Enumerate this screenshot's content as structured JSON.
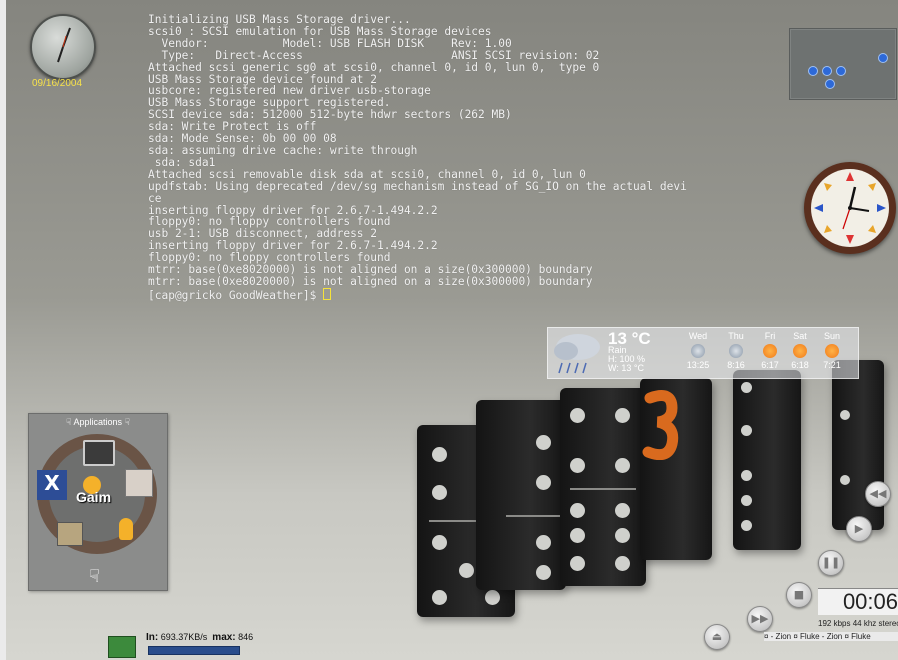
{
  "clock_widget": {
    "date": "09/16/2004"
  },
  "terminal": {
    "lines": [
      "Initializing USB Mass Storage driver...",
      "scsi0 : SCSI emulation for USB Mass Storage devices",
      "  Vendor:           Model: USB FLASH DISK    Rev: 1.00",
      "  Type:   Direct-Access                      ANSI SCSI revision: 02",
      "Attached scsi generic sg0 at scsi0, channel 0, id 0, lun 0,  type 0",
      "USB Mass Storage device found at 2",
      "usbcore: registered new driver usb-storage",
      "USB Mass Storage support registered.",
      "SCSI device sda: 512000 512-byte hdwr sectors (262 MB)",
      "sda: Write Protect is off",
      "sda: Mode Sense: 0b 00 00 08",
      "sda: assuming drive cache: write through",
      " sda: sda1",
      "Attached scsi removable disk sda at scsi0, channel 0, id 0, lun 0",
      "updfstab: Using deprecated /dev/sg mechanism instead of SG_IO on the actual devi",
      "ce",
      "inserting floppy driver for 2.6.7-1.494.2.2",
      "floppy0: no floppy controllers found",
      "usb 2-1: USB disconnect, address 2",
      "inserting floppy driver for 2.6.7-1.494.2.2",
      "floppy0: no floppy controllers found",
      "mtrr: base(0xe8020000) is not aligned on a size(0x300000) boundary",
      "mtrr: base(0xe8020000) is not aligned on a size(0x300000) boundary"
    ],
    "prompt": "[cap@gricko GoodWeather]$ "
  },
  "weather": {
    "temp": "13 °C",
    "condition": "Rain",
    "humidity": "H: 100 %",
    "wind": "W: 13 °C",
    "forecast": [
      {
        "day": "Wed",
        "time": "13:25",
        "icon": "storm-cloud-icon"
      },
      {
        "day": "Thu",
        "time": "8:16",
        "icon": "cloud-icon"
      },
      {
        "day": "Fri",
        "time": "6:17",
        "icon": "sun-icon"
      },
      {
        "day": "Sat",
        "time": "6:18",
        "icon": "sun-icon"
      },
      {
        "day": "Sun",
        "time": "7:21",
        "icon": "sun-icon"
      }
    ]
  },
  "launcher": {
    "title": "Applications",
    "center_label": "Gaim",
    "apps": [
      "terminal-icon",
      "xmms-icon",
      "gaim-icon",
      "package-icon",
      "calculator-icon",
      "user-icon"
    ]
  },
  "netmon": {
    "in_label": "In:",
    "in_value": "693.37KB/s",
    "max_label": "max:",
    "max_value": "846"
  },
  "player": {
    "time": "00:06",
    "bitrate": "192 kbps  44 khz  stereo",
    "track": "¤ - Zion ¤ Fluke - Zion ¤ Fluke"
  },
  "colors": {
    "terminal_text": "#f1f1f1",
    "date_text": "#f7e24a",
    "pager_dot": "#2d69d8"
  }
}
